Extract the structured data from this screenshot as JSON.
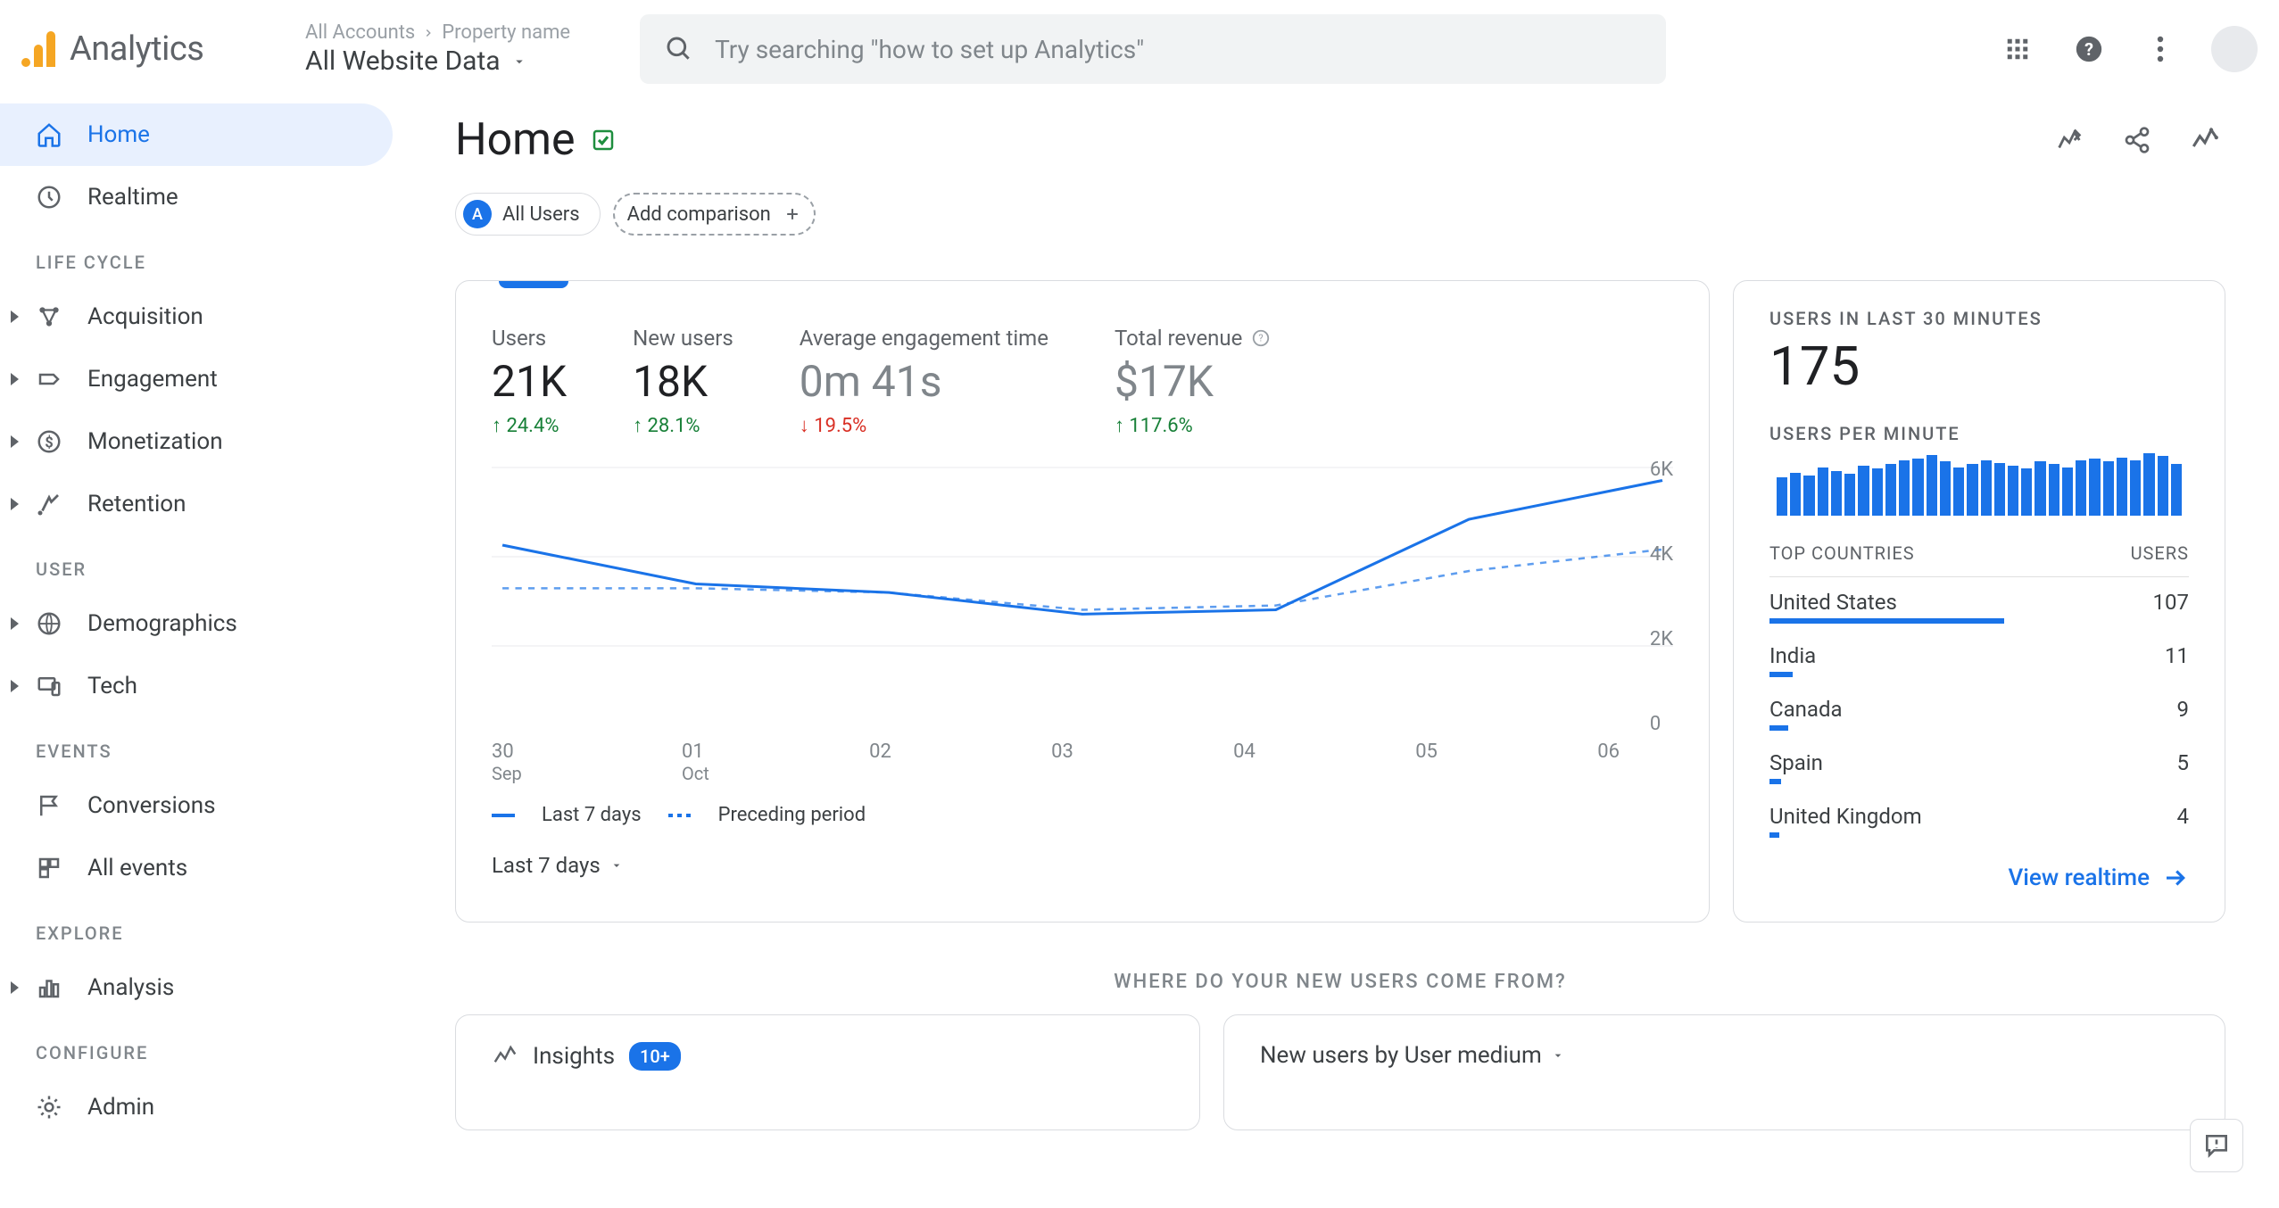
{
  "header": {
    "product": "Analytics",
    "breadcrumb_all": "All Accounts",
    "breadcrumb_prop": "Property name",
    "selector": "All Website Data",
    "search_placeholder": "Try searching \"how to set up Analytics\""
  },
  "sidebar": {
    "home": "Home",
    "realtime": "Realtime",
    "sect_life": "LIFE CYCLE",
    "acquisition": "Acquisition",
    "engagement": "Engagement",
    "monetization": "Monetization",
    "retention": "Retention",
    "sect_user": "USER",
    "demographics": "Demographics",
    "tech": "Tech",
    "sect_events": "EVENTS",
    "conversions": "Conversions",
    "all_events": "All events",
    "sect_explore": "EXPLORE",
    "analysis": "Analysis",
    "sect_configure": "CONFIGURE",
    "admin": "Admin"
  },
  "page": {
    "title": "Home",
    "segment_all": "All Users",
    "segment_a": "A",
    "add_comp": "Add comparison"
  },
  "metrics": [
    {
      "label": "Users",
      "value": "21K",
      "delta": "24.4%",
      "dir": "up"
    },
    {
      "label": "New users",
      "value": "18K",
      "delta": "28.1%",
      "dir": "up"
    },
    {
      "label": "Average engagement time",
      "value": "0m 41s",
      "delta": "19.5%",
      "dir": "down"
    },
    {
      "label": "Total revenue",
      "value": "$17K",
      "delta": "117.6%",
      "dir": "up",
      "help": true
    }
  ],
  "chart_data": {
    "type": "line",
    "xlabel": "",
    "ylabel": "",
    "ylim": [
      0,
      6000
    ],
    "y_ticks": [
      "6K",
      "4K",
      "2K",
      "0"
    ],
    "categories": [
      "30",
      "01",
      "02",
      "03",
      "04",
      "05",
      "06"
    ],
    "category_sub": {
      "0": "Sep",
      "1": "Oct"
    },
    "series": [
      {
        "name": "Last 7 days",
        "values": [
          4200,
          3300,
          3100,
          2600,
          2700,
          4800,
          5700
        ]
      },
      {
        "name": "Preceding period",
        "values": [
          3200,
          3200,
          3100,
          2700,
          2800,
          3600,
          4100
        ]
      }
    ],
    "date_range": "Last 7 days"
  },
  "realtime": {
    "label_30": "USERS IN LAST 30 MINUTES",
    "value_30": "175",
    "label_pm": "USERS PER MINUTE",
    "spark": [
      55,
      62,
      58,
      70,
      64,
      60,
      72,
      68,
      75,
      80,
      82,
      88,
      78,
      70,
      74,
      80,
      76,
      72,
      68,
      78,
      74,
      70,
      80,
      82,
      78,
      84,
      80,
      90,
      86,
      74
    ],
    "col_country": "TOP COUNTRIES",
    "col_users": "USERS",
    "countries": [
      {
        "name": "United States",
        "users": "107",
        "bar": 100
      },
      {
        "name": "India",
        "users": "11",
        "bar": 10
      },
      {
        "name": "Canada",
        "users": "9",
        "bar": 8
      },
      {
        "name": "Spain",
        "users": "5",
        "bar": 5
      },
      {
        "name": "United Kingdom",
        "users": "4",
        "bar": 4
      }
    ],
    "view": "View realtime"
  },
  "section2": {
    "title": "WHERE DO YOUR NEW USERS COME FROM?",
    "insights": "Insights",
    "insights_badge": "10+",
    "new_users": "New users by User medium"
  }
}
